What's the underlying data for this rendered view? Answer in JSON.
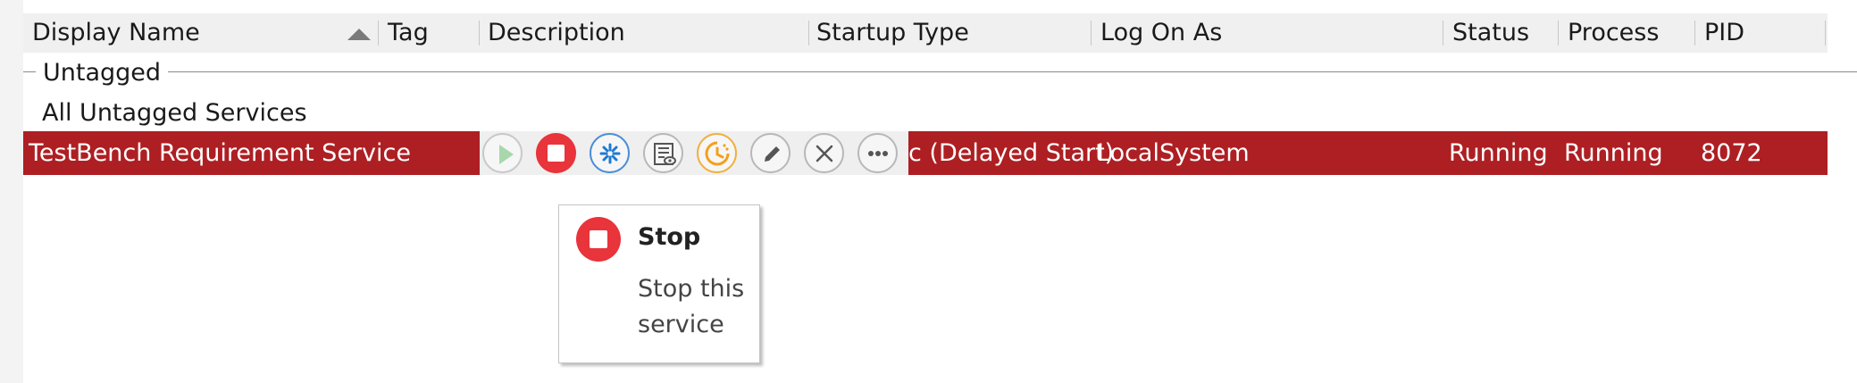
{
  "columns": {
    "display_name": "Display Name",
    "tag": "Tag",
    "description": "Description",
    "startup_type": "Startup Type",
    "log_on_as": "Log On As",
    "status": "Status",
    "process": "Process",
    "pid": "PID"
  },
  "group": {
    "label": "Untagged",
    "all_label": "All Untagged Services"
  },
  "row": {
    "display_name": "TestBench Requirement Service",
    "startup_type_visible": "c (Delayed Start)",
    "log_on_as": "LocalSystem",
    "status": "Running",
    "process": "Running",
    "pid": "8072"
  },
  "actions": [
    {
      "name": "start",
      "icon": "play-icon"
    },
    {
      "name": "stop",
      "icon": "stop-icon"
    },
    {
      "name": "restart",
      "icon": "restart-icon"
    },
    {
      "name": "view-log",
      "icon": "log-icon"
    },
    {
      "name": "startup-type",
      "icon": "clock-icon"
    },
    {
      "name": "edit",
      "icon": "pencil-icon"
    },
    {
      "name": "delete",
      "icon": "x-icon"
    },
    {
      "name": "more",
      "icon": "ellipsis-icon"
    }
  ],
  "tooltip": {
    "title": "Stop",
    "description": "Stop this service"
  },
  "colors": {
    "selected_row": "#ad1f23",
    "stop_red": "#e8343a",
    "restart_blue": "#1e7ad3",
    "clock_orange": "#f2a01e",
    "play_green": "#a8d7ac"
  }
}
